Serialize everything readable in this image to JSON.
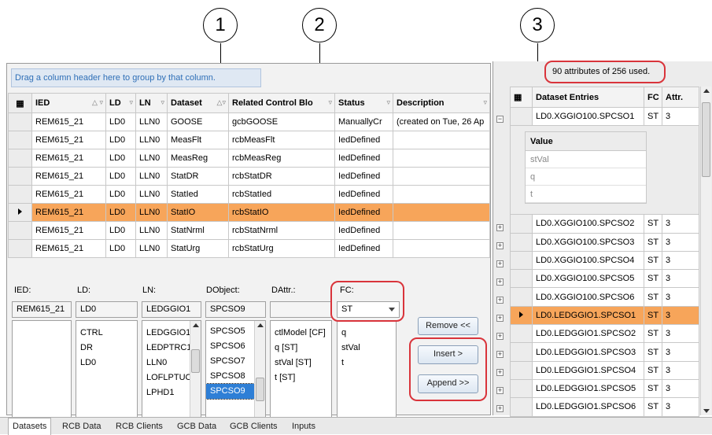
{
  "callouts": [
    "1",
    "2",
    "3"
  ],
  "group_panel_text": "Drag a column header here to group by that column.",
  "columns": [
    "IED",
    "LD",
    "LN",
    "Dataset",
    "Related Control Blo",
    "Status",
    "Description"
  ],
  "rows": [
    [
      "REM615_21",
      "LD0",
      "LLN0",
      "GOOSE",
      "gcbGOOSE",
      "ManuallyCr",
      "(created on Tue, 26 Ap"
    ],
    [
      "REM615_21",
      "LD0",
      "LLN0",
      "MeasFlt",
      "rcbMeasFlt",
      "IedDefined",
      ""
    ],
    [
      "REM615_21",
      "LD0",
      "LLN0",
      "MeasReg",
      "rcbMeasReg",
      "IedDefined",
      ""
    ],
    [
      "REM615_21",
      "LD0",
      "LLN0",
      "StatDR",
      "rcbStatDR",
      "IedDefined",
      ""
    ],
    [
      "REM615_21",
      "LD0",
      "LLN0",
      "StatIed",
      "rcbStatIed",
      "IedDefined",
      ""
    ],
    [
      "REM615_21",
      "LD0",
      "LLN0",
      "StatIO",
      "rcbStatIO",
      "IedDefined",
      ""
    ],
    [
      "REM615_21",
      "LD0",
      "LLN0",
      "StatNrml",
      "rcbStatNrml",
      "IedDefined",
      ""
    ],
    [
      "REM615_21",
      "LD0",
      "LLN0",
      "StatUrg",
      "rcbStatUrg",
      "IedDefined",
      ""
    ]
  ],
  "selection": {
    "ied_label": "IED:",
    "ied_value": "REM615_21",
    "ld_label": "LD:",
    "ld_value": "LD0",
    "ln_label": "LN:",
    "ln_value": "LEDGGIO1",
    "dobject_label": "DObject:",
    "dobject_value": "SPCSO9",
    "dattr_label": "DAttr.:",
    "dattr_value": "",
    "fc_label": "FC:",
    "fc_value": "ST"
  },
  "lists": {
    "ld": [
      "CTRL",
      "DR",
      "LD0"
    ],
    "ln": [
      "LEDGGIO1",
      "LEDPTRC1",
      "LLN0",
      "LOFLPTUC",
      "LPHD1"
    ],
    "dobject": [
      "SPCSO5",
      "SPCSO6",
      "SPCSO7",
      "SPCSO8",
      "SPCSO9"
    ],
    "dattr": [
      "ctlModel [CF]",
      "q [ST]",
      "stVal [ST]",
      "t [ST]"
    ],
    "fc_attrs": [
      "q",
      "stVal",
      "t"
    ]
  },
  "buttons": {
    "remove": "Remove <<",
    "insert": "Insert >",
    "append": "Append >>"
  },
  "attributes_used": "90 attributes of 256 used.",
  "entries_columns": [
    "Dataset Entries",
    "FC",
    "Attr."
  ],
  "entries": [
    [
      "LD0.XGGIO100.SPCSO1",
      "ST",
      "3"
    ],
    [
      "LD0.XGGIO100.SPCSO2",
      "ST",
      "3"
    ],
    [
      "LD0.XGGIO100.SPCSO3",
      "ST",
      "3"
    ],
    [
      "LD0.XGGIO100.SPCSO4",
      "ST",
      "3"
    ],
    [
      "LD0.XGGIO100.SPCSO5",
      "ST",
      "3"
    ],
    [
      "LD0.XGGIO100.SPCSO6",
      "ST",
      "3"
    ],
    [
      "LD0.LEDGGIO1.SPCSO1",
      "ST",
      "3"
    ],
    [
      "LD0.LEDGGIO1.SPCSO2",
      "ST",
      "3"
    ],
    [
      "LD0.LEDGGIO1.SPCSO3",
      "ST",
      "3"
    ],
    [
      "LD0.LEDGGIO1.SPCSO4",
      "ST",
      "3"
    ],
    [
      "LD0.LEDGGIO1.SPCSO5",
      "ST",
      "3"
    ],
    [
      "LD0.LEDGGIO1.SPCSO6",
      "ST",
      "3"
    ]
  ],
  "subgrid": {
    "header": "Value",
    "rows": [
      "stVal",
      "q",
      "t"
    ]
  },
  "tabs": [
    "Datasets",
    "RCB Data",
    "RCB Clients",
    "GCB Data",
    "GCB Clients",
    "Inputs"
  ],
  "colors": {
    "selected_row": "#f7a55a",
    "highlight_red": "#d9343b",
    "list_selection": "#2e7fd6",
    "group_text": "#2f6fb7"
  }
}
